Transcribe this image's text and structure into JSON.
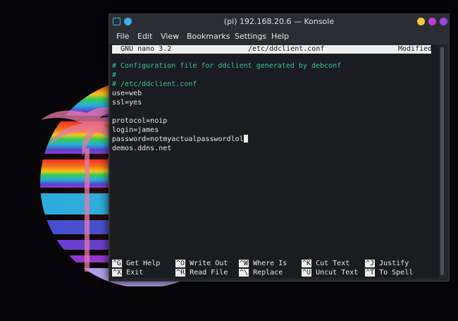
{
  "window": {
    "title": "(pi) 192.168.20.6 — Konsole"
  },
  "menubar": {
    "items": [
      {
        "label": "File"
      },
      {
        "label": "Edit"
      },
      {
        "label": "View"
      },
      {
        "label": "Bookmarks"
      },
      {
        "label": "Settings"
      },
      {
        "label": "Help"
      }
    ]
  },
  "nano": {
    "version": "GNU nano 3.2",
    "filename": "/etc/ddclient.conf",
    "status": "Modified",
    "lines": [
      {
        "text": ""
      },
      {
        "text": "# Configuration file for ddclient generated by debconf"
      },
      {
        "text": "#"
      },
      {
        "text": "# /etc/ddclient.conf"
      },
      {
        "text": "use=web"
      },
      {
        "text": "ssl=yes"
      },
      {
        "text": ""
      },
      {
        "text": "protocol=noip"
      },
      {
        "text": "login=james"
      },
      {
        "text": "password=notmyactualpasswordlol"
      },
      {
        "text": "demos.ddns.net"
      }
    ],
    "shortcuts_row1": [
      {
        "key": "^G",
        "label": "Get Help"
      },
      {
        "key": "^O",
        "label": "Write Out"
      },
      {
        "key": "^W",
        "label": "Where Is"
      },
      {
        "key": "^K",
        "label": "Cut Text"
      },
      {
        "key": "^J",
        "label": "Justify"
      }
    ],
    "shortcuts_row2": [
      {
        "key": "^X",
        "label": "Exit"
      },
      {
        "key": "^R",
        "label": "Read File"
      },
      {
        "key": "^\\",
        "label": "Replace"
      },
      {
        "key": "^U",
        "label": "Uncut Text"
      },
      {
        "key": "^T",
        "label": "To Spell"
      }
    ]
  },
  "colors": {
    "comment": "#3cc0a5",
    "terminal_bg": "#181a1d",
    "accent": "#3daee9"
  },
  "icons": {
    "app": "konsole-icon",
    "pin": "pin-icon",
    "minimize": "minimize-icon",
    "maximize": "maximize-icon",
    "close": "close-icon"
  }
}
